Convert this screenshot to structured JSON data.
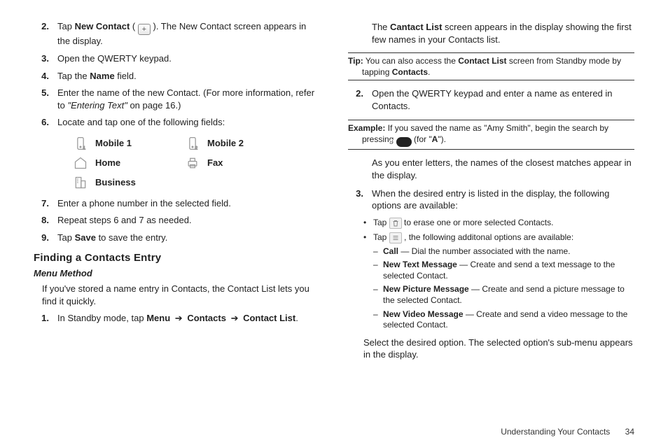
{
  "left": {
    "step2_a": "Tap ",
    "step2_b": "New Contact",
    "step2_c": " ( ",
    "step2_d": " ). The New Contact screen appears in the display.",
    "step3": "Open the QWERTY keypad.",
    "step4_a": "Tap the ",
    "step4_b": "Name",
    "step4_c": " field.",
    "step5_a": "Enter the name of the new Contact. (For more information, refer to ",
    "step5_b": "\"Entering Text\"",
    "step5_c": "  on page 16.)",
    "step6": "Locate and tap one of the following fields:",
    "fields": {
      "mobile1": "Mobile 1",
      "mobile2": "Mobile 2",
      "home": "Home",
      "fax": "Fax",
      "business": "Business"
    },
    "step7": "Enter a phone number in the selected field.",
    "step8": "Repeat steps 6 and 7 as needed.",
    "step9_a": "Tap ",
    "step9_b": "Save",
    "step9_c": " to save the entry.",
    "h3": "Finding a Contacts Entry",
    "h4": "Menu Method",
    "para1": "If you've stored a name entry in Contacts, the Contact List lets you find it quickly.",
    "step1b_a": "In Standby mode, tap ",
    "step1b_menu": "Menu",
    "step1b_contacts": "Contacts",
    "step1b_list": "Contact List",
    "arrow": "➔",
    "dot": "."
  },
  "right": {
    "top_a": "The ",
    "top_b": "Cantact List",
    "top_c": " screen appears in the display showing the first few names in your Contacts list.",
    "tip_label": "Tip:",
    "tip_a": " You can also access the ",
    "tip_b": "Contact List",
    "tip_c": " screen from Standby mode by tapping ",
    "tip_d": "Contacts",
    "tip_e": ".",
    "step2": "Open the QWERTY keypad and enter a name as entered in Contacts.",
    "ex_label": "Example:",
    "ex_a": " If you saved the name as \"Amy Smith\", begin the search by pressing ",
    "ex_b": " (for \"",
    "ex_c": "A",
    "ex_d": "\").",
    "match": "As you enter letters, the names of the closest matches appear in the display.",
    "step3": "When the desired entry is listed in the display, the following options are available:",
    "b1_a": "Tap ",
    "b1_b": " to erase one or more selected Contacts.",
    "b2_a": "Tap ",
    "b2_b": " , the following additonal options are available:",
    "d1_b": "Call",
    "d1_t": " — Dial the number associated with the name.",
    "d2_b": "New Text Message",
    "d2_t": " — Create and send a text message to the selected Contact.",
    "d3_b": "New Picture Message",
    "d3_t": " — Create and send a picture message to the selected Contact.",
    "d4_b": "New Video Message",
    "d4_t": " — Create and send a video message to the selected Contact.",
    "select": "Select the desired option. The selected option's sub-menu appears in the display."
  },
  "nums": {
    "n1": "1.",
    "n2": "2.",
    "n3": "3.",
    "n4": "4.",
    "n5": "5.",
    "n6": "6.",
    "n7": "7.",
    "n8": "8.",
    "n9": "9."
  },
  "bullet": "•",
  "dash": "–",
  "footer": {
    "section": "Understanding Your Contacts",
    "page": "34"
  }
}
